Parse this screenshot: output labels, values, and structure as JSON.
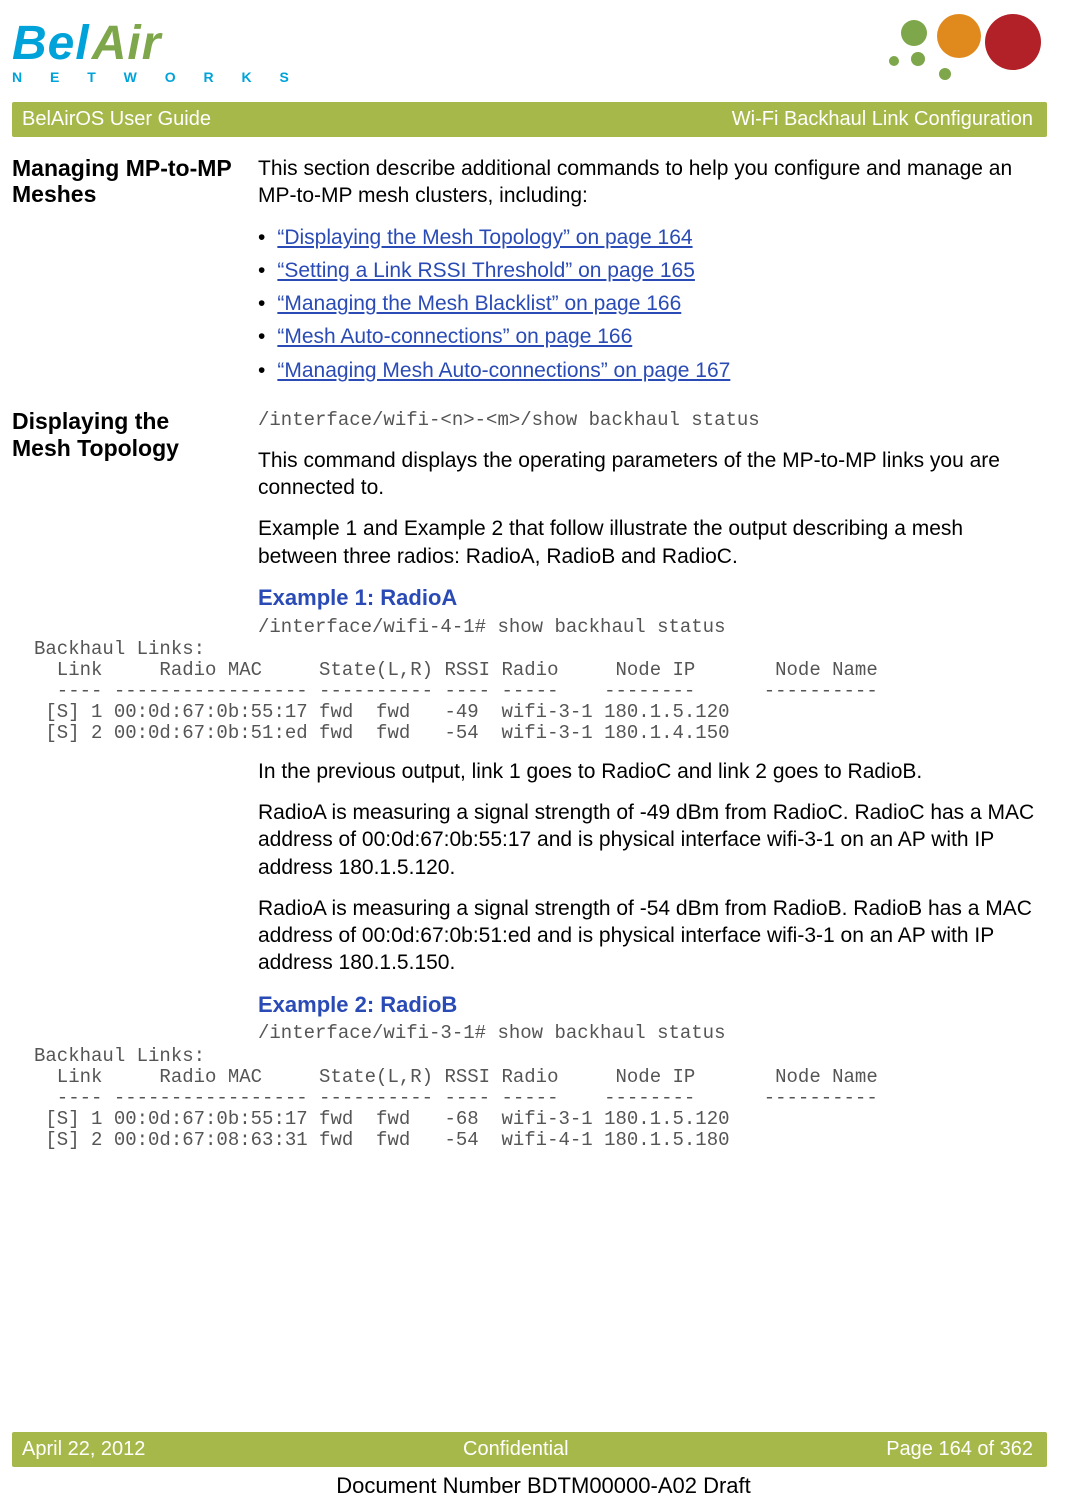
{
  "logo": {
    "bel": "Bel",
    "air": "Air",
    "networks": "N E T W O R K S"
  },
  "topbar": {
    "left": "BelAirOS User Guide",
    "right": "Wi-Fi Backhaul Link Configuration"
  },
  "s1": {
    "heading": "Managing MP-to-MP Meshes",
    "intro": "This section describe additional commands to help you configure and manage an MP-to-MP mesh clusters, including:",
    "links": [
      "“Displaying the Mesh Topology” on page 164",
      "“Setting a Link RSSI Threshold” on page 165",
      "“Managing the Mesh Blacklist” on page 166",
      "“Mesh Auto-connections” on page 166",
      "“Managing Mesh Auto-connections” on page 167"
    ]
  },
  "s2": {
    "heading": "Displaying the Mesh Topology",
    "cmd": "/interface/wifi-<n>-<m>/show backhaul status",
    "p1": "This command displays the operating parameters of the MP-to-MP links you are connected to.",
    "p2": "Example 1 and Example 2 that follow illustrate the output describing a mesh between three radios: RadioA, RadioB and RadioC.",
    "ex1_head": "Example 1: RadioA",
    "ex1_cmd": "/interface/wifi-4-1# show backhaul status",
    "ex1_out": "Backhaul Links:\n  Link     Radio MAC     State(L,R) RSSI Radio     Node IP       Node Name\n  ---- ----------------- ---------- ---- -----    --------      ----------\n [S] 1 00:0d:67:0b:55:17 fwd  fwd   -49  wifi-3-1 180.1.5.120\n [S] 2 00:0d:67:0b:51:ed fwd  fwd   -54  wifi-3-1 180.1.4.150",
    "p3": "In the previous output, link 1 goes to RadioC and link 2 goes to RadioB.",
    "p4": "RadioA is measuring a signal strength of -49 dBm from RadioC. RadioC has a MAC address of 00:0d:67:0b:55:17 and is physical interface wifi-3-1 on an AP with IP address 180.1.5.120.",
    "p5": "RadioA is measuring a signal strength of -54 dBm from RadioB. RadioB has a MAC address of 00:0d:67:0b:51:ed and is physical interface wifi-3-1 on an AP with IP address 180.1.5.150.",
    "ex2_head": "Example 2: RadioB",
    "ex2_cmd": "/interface/wifi-3-1# show backhaul status",
    "ex2_out": "Backhaul Links:\n  Link     Radio MAC     State(L,R) RSSI Radio     Node IP       Node Name\n  ---- ----------------- ---------- ---- -----    --------      ----------\n [S] 1 00:0d:67:0b:55:17 fwd  fwd   -68  wifi-3-1 180.1.5.120\n [S] 2 00:0d:67:08:63:31 fwd  fwd   -54  wifi-4-1 180.1.5.180"
  },
  "botbar": {
    "left": "April 22, 2012",
    "mid": "Confidential",
    "right": "Page 164 of 362"
  },
  "docnum": "Document Number BDTM00000-A02 Draft"
}
